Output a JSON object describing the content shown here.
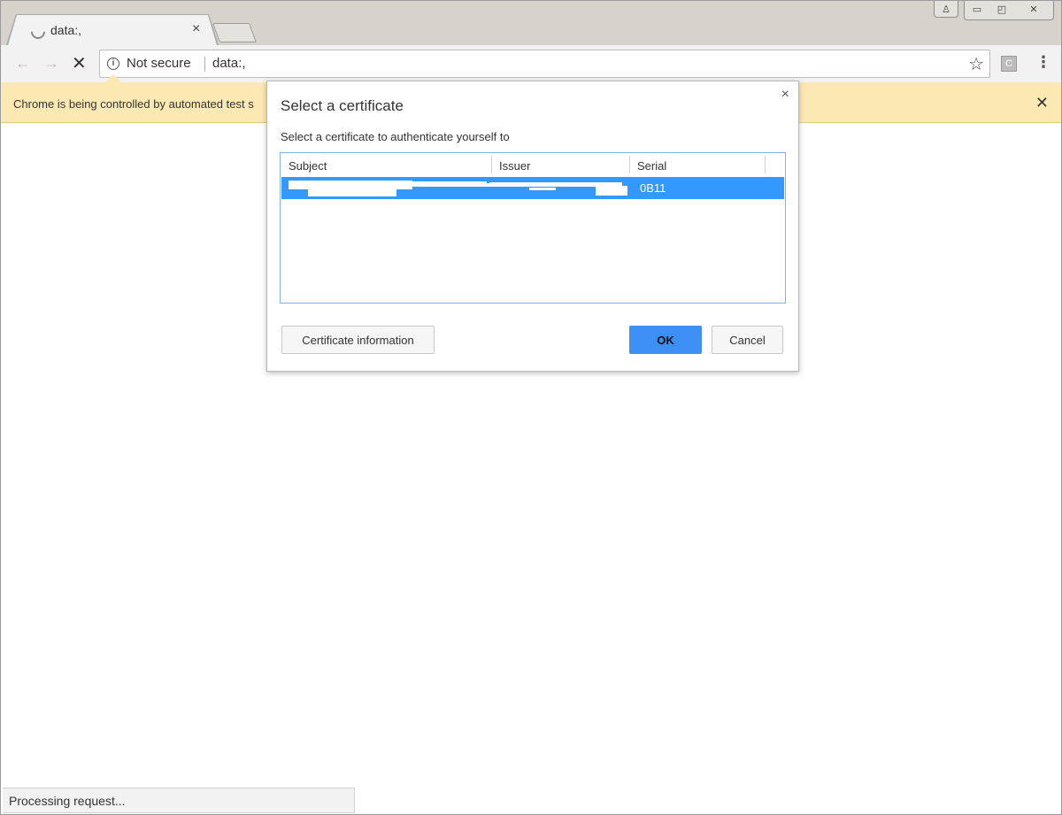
{
  "tab": {
    "title": "data:,",
    "close": "×"
  },
  "window_controls": {
    "profile": "♙",
    "minimize": "▭",
    "restore": "◰",
    "close": "✕"
  },
  "toolbar": {
    "back": "←",
    "forward": "→",
    "stop": "✕",
    "security_label": "Not secure",
    "url": "data:,",
    "bookmark": "☆",
    "extension_label": "C",
    "menu": "⋮"
  },
  "infobar": {
    "text": "Chrome is being controlled by automated test s",
    "close": "✕"
  },
  "dialog": {
    "title": "Select a certificate",
    "description": "Select a certificate to authenticate yourself to",
    "close": "×",
    "columns": [
      "Subject",
      "Issuer",
      "Serial"
    ],
    "rows": [
      {
        "serial": "0B11",
        "selected": true
      }
    ],
    "buttons": {
      "certificate_info": "Certificate information",
      "ok": "OK",
      "cancel": "Cancel"
    },
    "colors": {
      "selection": "#3399ff",
      "ok_button": "#3d8ff5"
    }
  },
  "status": {
    "text": "Processing request..."
  }
}
